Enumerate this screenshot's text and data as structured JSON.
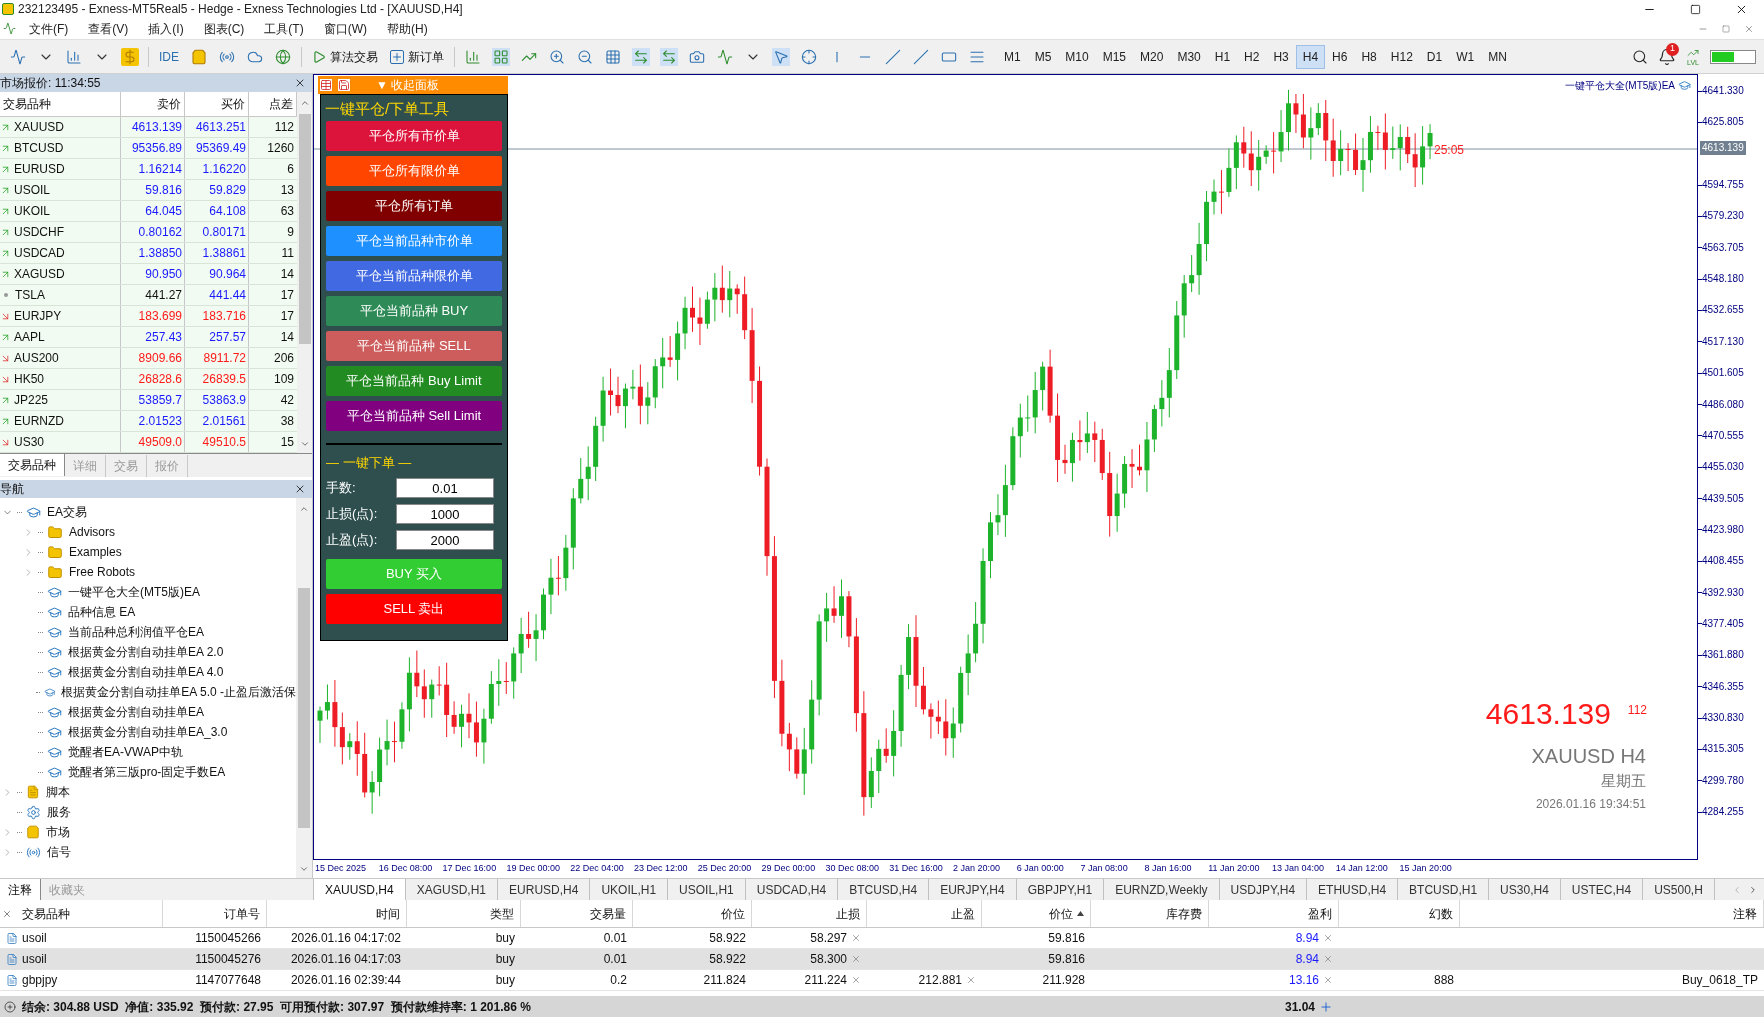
{
  "window": {
    "title": "232123495 - Exness-MT5Real5 - Hedge - Exness Technologies Ltd - [XAUUSD,H4]"
  },
  "menu": [
    "文件(F)",
    "查看(V)",
    "插入(I)",
    "图表(C)",
    "工具(T)",
    "窗口(W)",
    "帮助(H)"
  ],
  "toolbar": {
    "ide": "IDE",
    "algo_trading": "算法交易",
    "new_order": "新订单",
    "timeframes": [
      {
        "label": "M1",
        "selected": false
      },
      {
        "label": "M5",
        "selected": false
      },
      {
        "label": "M10",
        "selected": false
      },
      {
        "label": "M15",
        "selected": false
      },
      {
        "label": "M20",
        "selected": false
      },
      {
        "label": "M30",
        "selected": false
      },
      {
        "label": "H1",
        "selected": false
      },
      {
        "label": "H2",
        "selected": false
      },
      {
        "label": "H3",
        "selected": false
      },
      {
        "label": "H4",
        "selected": true
      },
      {
        "label": "H6",
        "selected": false
      },
      {
        "label": "H8",
        "selected": false
      },
      {
        "label": "H12",
        "selected": false
      },
      {
        "label": "D1",
        "selected": false
      },
      {
        "label": "W1",
        "selected": false
      },
      {
        "label": "MN",
        "selected": false
      }
    ],
    "notifications": "1",
    "level": "LVL"
  },
  "market_watch": {
    "title": "市场报价: 11:34:55",
    "columns": [
      "交易品种",
      "卖价",
      "买价",
      "点差"
    ],
    "rows": [
      {
        "symbol": "XAUUSD",
        "bid": "4613.139",
        "ask": "4613.251",
        "spread": "112",
        "kind": "up"
      },
      {
        "symbol": "BTCUSD",
        "bid": "95356.89",
        "ask": "95369.49",
        "spread": "1260",
        "kind": "up"
      },
      {
        "symbol": "EURUSD",
        "bid": "1.16214",
        "ask": "1.16220",
        "spread": "6",
        "kind": "up"
      },
      {
        "symbol": "USOIL",
        "bid": "59.816",
        "ask": "59.829",
        "spread": "13",
        "kind": "up"
      },
      {
        "symbol": "UKOIL",
        "bid": "64.045",
        "ask": "64.108",
        "spread": "63",
        "kind": "up"
      },
      {
        "symbol": "USDCHF",
        "bid": "0.80162",
        "ask": "0.80171",
        "spread": "9",
        "kind": "up"
      },
      {
        "symbol": "USDCAD",
        "bid": "1.38850",
        "ask": "1.38861",
        "spread": "11",
        "kind": "up"
      },
      {
        "symbol": "XAGUSD",
        "bid": "90.950",
        "ask": "90.964",
        "spread": "14",
        "kind": "up"
      },
      {
        "symbol": "TSLA",
        "bid": "441.27",
        "ask": "441.44",
        "spread": "17",
        "kind": "flat"
      },
      {
        "symbol": "EURJPY",
        "bid": "183.699",
        "ask": "183.716",
        "spread": "17",
        "kind": "down"
      },
      {
        "symbol": "AAPL",
        "bid": "257.43",
        "ask": "257.57",
        "spread": "14",
        "kind": "up"
      },
      {
        "symbol": "AUS200",
        "bid": "8909.66",
        "ask": "8911.72",
        "spread": "206",
        "kind": "down"
      },
      {
        "symbol": "HK50",
        "bid": "26828.6",
        "ask": "26839.5",
        "spread": "109",
        "kind": "down"
      },
      {
        "symbol": "JP225",
        "bid": "53859.7",
        "ask": "53863.9",
        "spread": "42",
        "kind": "up"
      },
      {
        "symbol": "EURNZD",
        "bid": "2.01523",
        "ask": "2.01561",
        "spread": "38",
        "kind": "up"
      },
      {
        "symbol": "US30",
        "bid": "49509.0",
        "ask": "49510.5",
        "spread": "15",
        "kind": "down"
      }
    ],
    "tabs": [
      {
        "label": "交易品种",
        "selected": true
      },
      {
        "label": "详细",
        "selected": false
      },
      {
        "label": "交易",
        "selected": false
      },
      {
        "label": "报价",
        "selected": false
      }
    ]
  },
  "navigator": {
    "title": "导航",
    "items": [
      {
        "label": "EA交易",
        "kind": "ea",
        "expanded": true,
        "children": [
          {
            "label": "Advisors",
            "kind": "folder",
            "expanded": false
          },
          {
            "label": "Examples",
            "kind": "folder",
            "expanded": false
          },
          {
            "label": "Free Robots",
            "kind": "folder",
            "expanded": false
          },
          {
            "label": "一键平仓大全(MT5版)EA",
            "kind": "ea"
          },
          {
            "label": "品种信息 EA",
            "kind": "ea"
          },
          {
            "label": "当前品种总利润值平仓EA",
            "kind": "ea"
          },
          {
            "label": "根据黄金分割自动挂单EA 2.0",
            "kind": "ea"
          },
          {
            "label": "根据黄金分割自动挂单EA 4.0",
            "kind": "ea"
          },
          {
            "label": "根据黄金分割自动挂单EA 5.0 -止盈后激活保",
            "kind": "ea"
          },
          {
            "label": "根据黄金分割自动挂单EA",
            "kind": "ea"
          },
          {
            "label": "根据黄金分割自动挂单EA_3.0",
            "kind": "ea"
          },
          {
            "label": "觉醒者EA-VWAP中轨",
            "kind": "ea"
          },
          {
            "label": "觉醒者第三版pro-固定手数EA",
            "kind": "ea"
          }
        ]
      },
      {
        "label": "脚本",
        "kind": "script",
        "expanded": false
      },
      {
        "label": "服务",
        "kind": "service"
      },
      {
        "label": "市场",
        "kind": "market",
        "expanded": false
      },
      {
        "label": "信号",
        "kind": "signal",
        "expanded": false
      }
    ]
  },
  "ea_panel": {
    "toggle": "▼ 收起面板",
    "title": "一键平仓/下单工具",
    "buttons": [
      {
        "label": "平仓所有市价单",
        "color": "#dc143c"
      },
      {
        "label": "平仓所有限价单",
        "color": "#ff4500"
      },
      {
        "label": "平仓所有订单",
        "color": "#800000"
      },
      {
        "label": "平仓当前品种市价单",
        "color": "#1e90ff"
      },
      {
        "label": "平仓当前品种限价单",
        "color": "#4169e1"
      },
      {
        "label": "平仓当前品种 BUY",
        "color": "#2e8b57"
      },
      {
        "label": "平仓当前品种 SELL",
        "color": "#cd5c5c"
      },
      {
        "label": "平仓当前品种 Buy Limit",
        "color": "#228b22"
      },
      {
        "label": "平仓当前品种 Sell Limit",
        "color": "#800080"
      }
    ],
    "order_title": "— 一键下单 —",
    "fields": [
      {
        "label": "手数:",
        "value": "0.01"
      },
      {
        "label": "止损(点):",
        "value": "1000"
      },
      {
        "label": "止盈(点):",
        "value": "2000"
      }
    ],
    "actions": [
      {
        "label": "BUY 买入",
        "color": "#32cd32"
      },
      {
        "label": "SELL 卖出",
        "color": "#ff0000"
      }
    ]
  },
  "chart": {
    "ea_label": "一键平仓大全(MT5版)EA",
    "line_label": "25:05",
    "price_tag": "4613.139",
    "price": "4613.139",
    "spread": "112",
    "symbol": "XAUUSD H4",
    "weekday": "星期五",
    "datetime": "2026.01.16 19:34:51",
    "price_axis": [
      "4641.330",
      "4625.805",
      "4594.755",
      "4579.230",
      "4563.705",
      "4548.180",
      "4532.655",
      "4517.130",
      "4501.605",
      "4486.080",
      "4470.555",
      "4455.030",
      "4439.505",
      "4423.980",
      "4408.455",
      "4392.930",
      "4377.405",
      "4361.880",
      "4346.355",
      "4330.830",
      "4315.305",
      "4299.780",
      "4284.255"
    ],
    "time_axis": [
      "15 Dec 2025",
      "16 Dec 08:00",
      "17 Dec 16:00",
      "19 Dec 00:00",
      "22 Dec 04:00",
      "23 Dec 12:00",
      "25 Dec 20:00",
      "29 Dec 00:00",
      "30 Dec 08:00",
      "31 Dec 16:00",
      "2 Jan 20:00",
      "6 Jan 00:00",
      "7 Jan 08:00",
      "8 Jan 16:00",
      "11 Jan 20:00",
      "13 Jan 04:00",
      "14 Jan 12:00",
      "15 Jan 20:00"
    ]
  },
  "left_tabs": [
    {
      "label": "注释",
      "selected": true
    },
    {
      "label": "收藏夹",
      "selected": false
    }
  ],
  "chart_tabs": [
    {
      "label": "XAUUSD,H4",
      "selected": true
    },
    {
      "label": "XAGUSD,H1",
      "selected": false
    },
    {
      "label": "EURUSD,H4",
      "selected": false
    },
    {
      "label": "UKOIL,H1",
      "selected": false
    },
    {
      "label": "USOIL,H1",
      "selected": false
    },
    {
      "label": "USDCAD,H4",
      "selected": false
    },
    {
      "label": "BTCUSD,H4",
      "selected": false
    },
    {
      "label": "EURJPY,H4",
      "selected": false
    },
    {
      "label": "GBPJPY,H1",
      "selected": false
    },
    {
      "label": "EURNZD,Weekly",
      "selected": false
    },
    {
      "label": "USDJPY,H4",
      "selected": false
    },
    {
      "label": "ETHUSD,H4",
      "selected": false
    },
    {
      "label": "BTCUSD,H1",
      "selected": false
    },
    {
      "label": "US30,H4",
      "selected": false
    },
    {
      "label": "USTEC,H4",
      "selected": false
    },
    {
      "label": "US500,H",
      "selected": false
    }
  ],
  "trade_table": {
    "columns": [
      {
        "label": "交易品种",
        "kind": "symbol"
      },
      {
        "label": "订单号",
        "kind": "number"
      },
      {
        "label": "时间",
        "kind": "number"
      },
      {
        "label": "类型",
        "kind": "number"
      },
      {
        "label": "交易量",
        "kind": "number"
      },
      {
        "label": "价位",
        "kind": "number"
      },
      {
        "label": "止损",
        "kind": "number",
        "removable": true
      },
      {
        "label": "止盈",
        "kind": "number",
        "removable": true
      },
      {
        "label": "价位",
        "kind": "number",
        "sorted": true
      },
      {
        "label": "库存费",
        "kind": "number"
      },
      {
        "label": "盈利",
        "kind": "profit",
        "removable": true
      },
      {
        "label": "幻数",
        "kind": "number"
      },
      {
        "label": "注释",
        "kind": "number"
      }
    ],
    "rows": [
      {
        "selected": false,
        "cells": [
          "usoil",
          "1150045266",
          "2026.01.16 04:17:02",
          "buy",
          "0.01",
          "58.922",
          "58.297",
          "",
          "59.816",
          "",
          "8.94",
          "",
          ""
        ]
      },
      {
        "selected": true,
        "cells": [
          "usoil",
          "1150045276",
          "2026.01.16 04:17:03",
          "buy",
          "0.01",
          "58.922",
          "58.300",
          "",
          "59.816",
          "",
          "8.94",
          "",
          ""
        ]
      },
      {
        "selected": false,
        "cells": [
          "gbpjpy",
          "1147077648",
          "2026.01.16 02:39:44",
          "buy",
          "0.2",
          "211.824",
          "211.224",
          "212.881",
          "211.928",
          "",
          "13.16",
          "888",
          "Buy_0618_TP"
        ]
      }
    ]
  },
  "status_bar": {
    "summary": "结余: 304.88 USD  净值: 335.92  预付款: 27.95  可用预付款: 307.97  预付款维持率: 1 201.86 %",
    "profit": "31.04"
  }
}
